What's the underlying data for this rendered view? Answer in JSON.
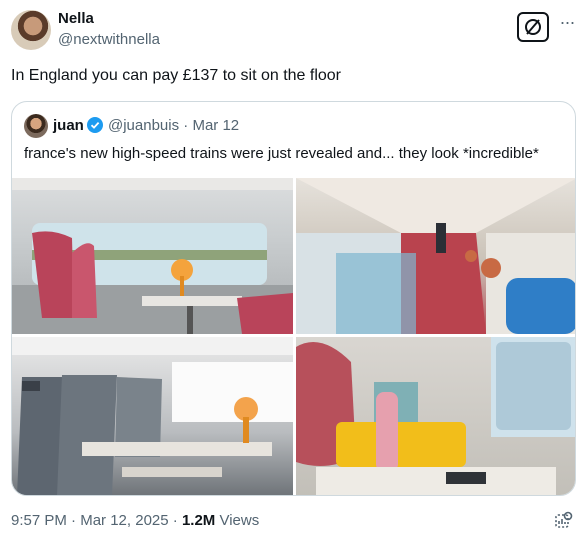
{
  "author": {
    "name": "Nella",
    "handle": "@nextwithnella"
  },
  "tweet": {
    "text": "In England you can pay £137 to sit on the floor"
  },
  "quote": {
    "name": "juan",
    "handle": "@juanbuis",
    "separator": "·",
    "date": "Mar 12",
    "text": "france's new high-speed trains were just revealed and... they look *incredible*"
  },
  "meta": {
    "time": "9:57 PM",
    "separator": "·",
    "date": "Mar 12, 2025",
    "views_count": "1.2M",
    "views_label": "Views"
  },
  "icons": [
    "grok-icon",
    "more-icon",
    "verified-icon",
    "analytics-icon"
  ],
  "colors": {
    "verified": "#1d9bf0",
    "secondary_text": "#536471",
    "border": "#cfd9de"
  }
}
